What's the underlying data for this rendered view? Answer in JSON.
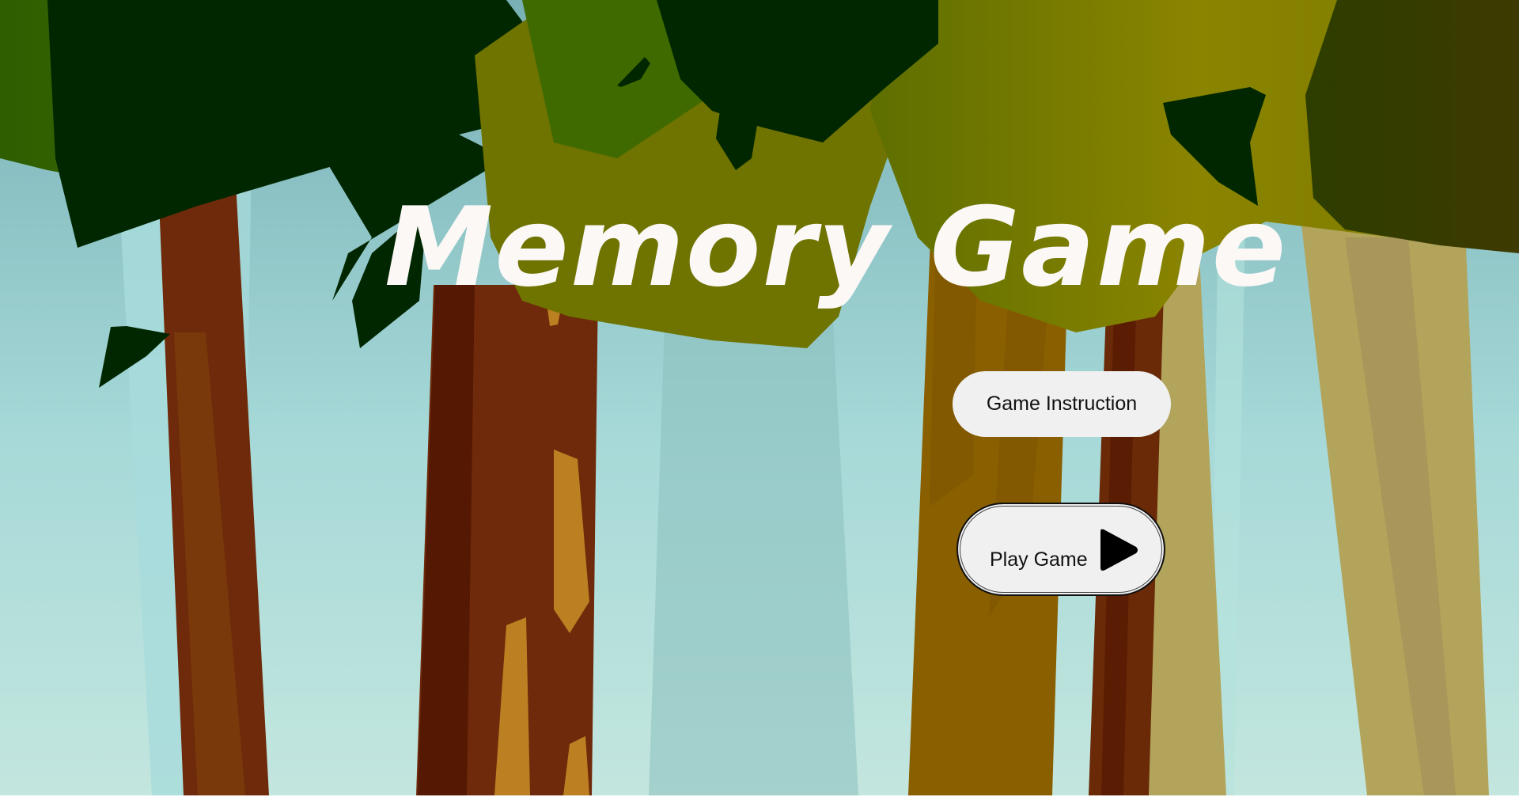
{
  "game": {
    "title": "Memory Game"
  },
  "menu": {
    "instruction_label": "Game Instruction",
    "play_label": "Play Game",
    "play_icon": "play-triangle-icon"
  },
  "colors": {
    "sky_top": "#7fb7bb",
    "sky_bottom": "#c3e6de",
    "canopy_dark": "#002700",
    "canopy_green": "#3f6a00",
    "canopy_olive": "#807a00",
    "trunk_brown": "#6e2a0a",
    "trunk_ochre": "#8a5f00",
    "trunk_khaki": "#b2a45b",
    "button_bg": "#f0f0f0",
    "title_color": "#fbf8f6"
  }
}
